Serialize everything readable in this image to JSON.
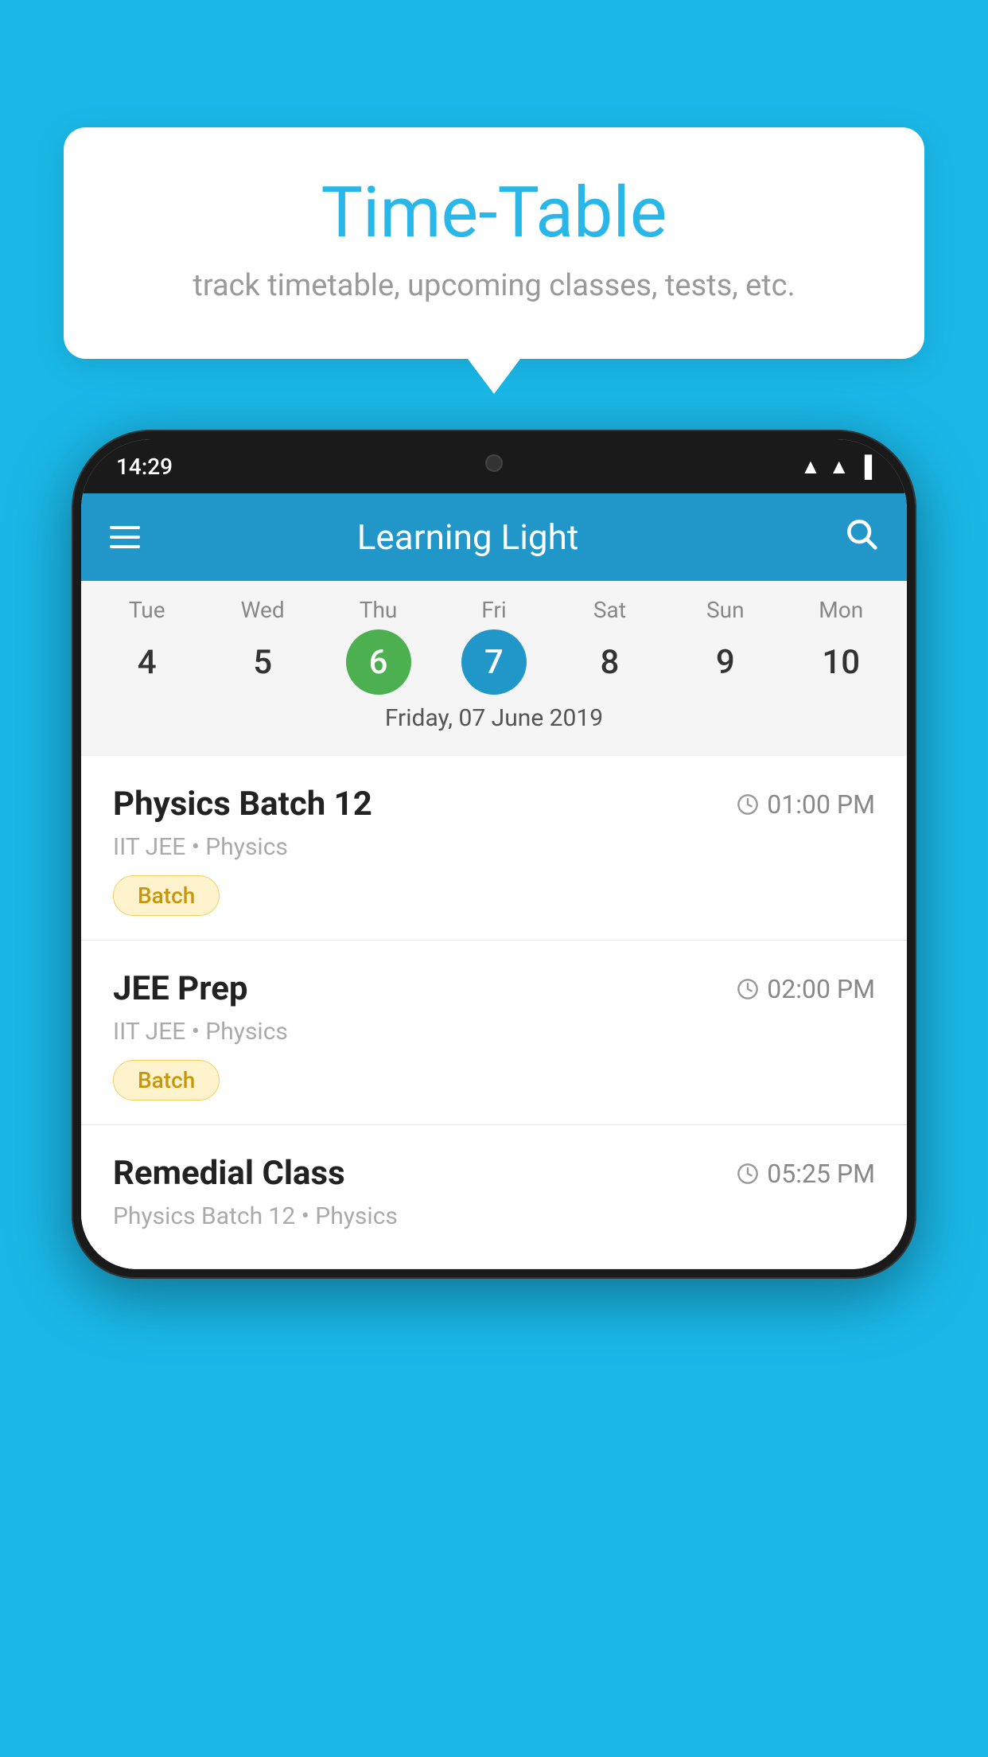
{
  "background_color": "#1ab8e8",
  "tooltip": {
    "title": "Time-Table",
    "subtitle": "track timetable, upcoming classes, tests, etc."
  },
  "phone": {
    "status_bar": {
      "time": "14:29"
    },
    "app_bar": {
      "title": "Learning Light"
    },
    "calendar": {
      "days": [
        {
          "name": "Tue",
          "num": "4",
          "state": "normal"
        },
        {
          "name": "Wed",
          "num": "5",
          "state": "normal"
        },
        {
          "name": "Thu",
          "num": "6",
          "state": "today"
        },
        {
          "name": "Fri",
          "num": "7",
          "state": "selected"
        },
        {
          "name": "Sat",
          "num": "8",
          "state": "normal"
        },
        {
          "name": "Sun",
          "num": "9",
          "state": "normal"
        },
        {
          "name": "Mon",
          "num": "10",
          "state": "normal"
        }
      ],
      "selected_date_label": "Friday, 07 June 2019"
    },
    "events": [
      {
        "name": "Physics Batch 12",
        "time": "01:00 PM",
        "meta": "IIT JEE • Physics",
        "badge": "Batch"
      },
      {
        "name": "JEE Prep",
        "time": "02:00 PM",
        "meta": "IIT JEE • Physics",
        "badge": "Batch"
      },
      {
        "name": "Remedial Class",
        "time": "05:25 PM",
        "meta": "Physics Batch 12 • Physics",
        "badge": null
      }
    ]
  }
}
